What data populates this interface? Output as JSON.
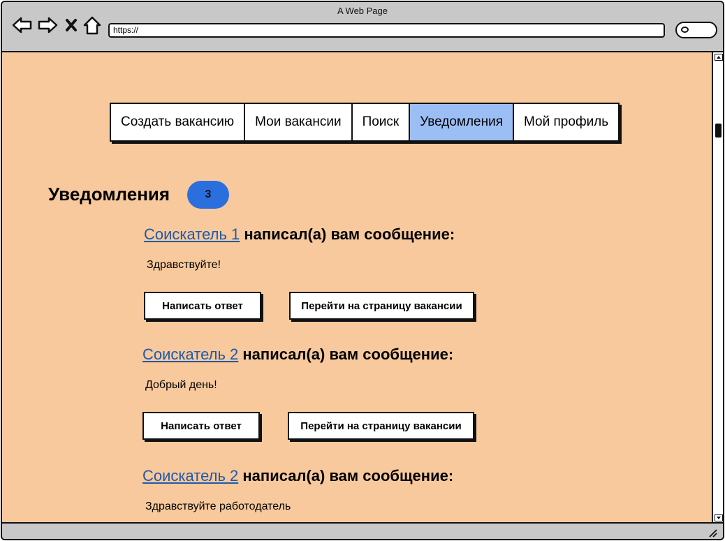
{
  "browser": {
    "title": "A Web Page",
    "url": "https://",
    "icons": [
      "back-arrow-icon",
      "forward-arrow-icon",
      "close-x-icon",
      "home-icon",
      "search-icon"
    ]
  },
  "nav": {
    "tabs": [
      {
        "label": "Создать вакансию",
        "active": false
      },
      {
        "label": "Мои вакансии",
        "active": false
      },
      {
        "label": "Поиск",
        "active": false
      },
      {
        "label": "Уведомления",
        "active": true
      },
      {
        "label": "Мой профиль",
        "active": false
      }
    ],
    "active_color": "#9bbef5"
  },
  "page": {
    "title": "Уведомления",
    "count": "3",
    "background": "#f8c99c",
    "badge_color": "#2b6fde",
    "link_color": "#1f5aa8"
  },
  "notifications": [
    {
      "sender": "Соискатель 1",
      "action": "написал(а) вам сообщение:",
      "message": "Здравствуйте!",
      "reply_label": "Написать ответ",
      "vacancy_label": "Перейти на страницу вакансии"
    },
    {
      "sender": "Соискатель 2",
      "action": "написал(а) вам сообщение:",
      "message": "Добрый день!",
      "reply_label": "Написать ответ",
      "vacancy_label": "Перейти на страницу вакансии"
    },
    {
      "sender": "Соискатель 2",
      "action": "написал(а) вам сообщение:",
      "message": "Здравствуйте работодатель"
    }
  ]
}
